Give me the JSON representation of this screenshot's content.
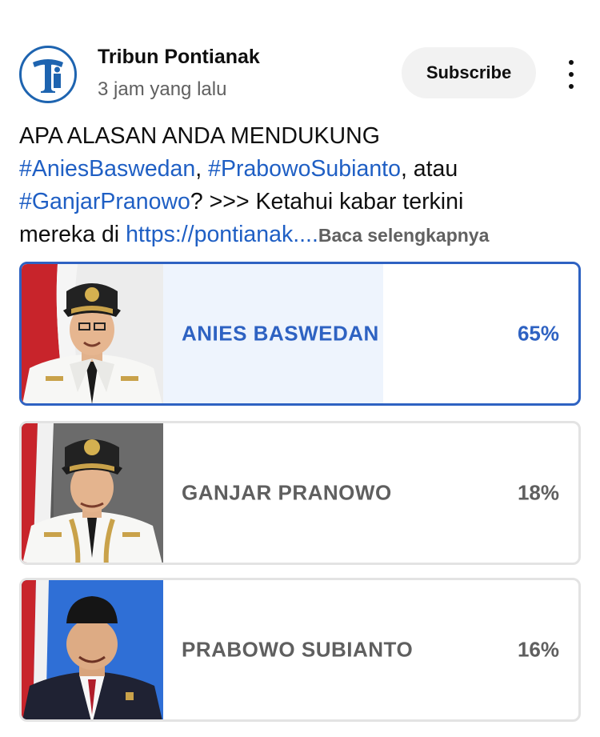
{
  "post": {
    "channel_name": "Tribun Pontianak",
    "time": "3 jam yang lalu",
    "subscribe_label": "Subscribe",
    "avatar_icon": "tribun-logo-icon",
    "more_icon": "more-vert-icon",
    "text": {
      "line1": "APA ALASAN ANDA MENDUKUNG",
      "tag1": "#AniesBaswedan",
      "sep1": ", ",
      "tag2": "#PrabowoSubianto",
      "sep2": ", atau",
      "tag3": "#GanjarPranowo",
      "after_tag3": "? >>> Ketahui kabar terkini",
      "before_link": "mereka di ",
      "link": "https://pontianak....",
      "read_more": "Baca selengkapnya"
    }
  },
  "poll": {
    "options": [
      {
        "label": "ANIES BASWEDAN",
        "percent_text": "65%",
        "percent": 65,
        "selected": true
      },
      {
        "label": "GANJAR PRANOWO",
        "percent_text": "18%",
        "percent": 18,
        "selected": false
      },
      {
        "label": "PRABOWO SUBIANTO",
        "percent_text": "16%",
        "percent": 16,
        "selected": false
      }
    ]
  },
  "colors": {
    "accent": "#2e62c2",
    "link": "#1f5fc4",
    "selected_fill": "#eef4fd",
    "unselected_fill": "#e6e6e6"
  }
}
